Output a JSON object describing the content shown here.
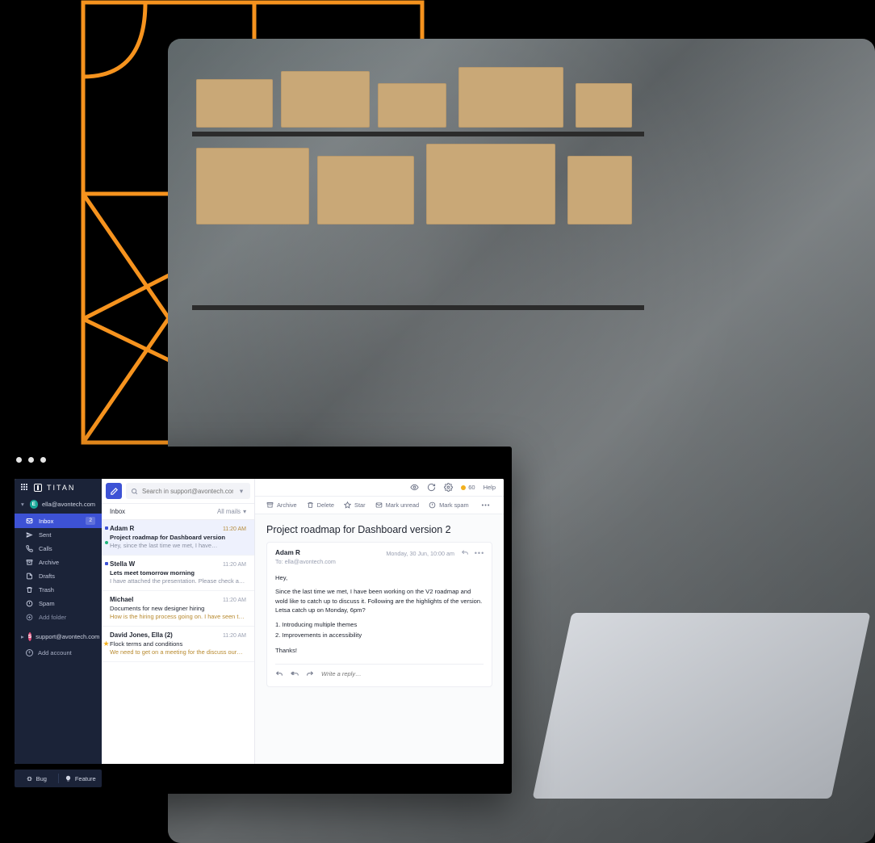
{
  "app": {
    "brand": "TITAN",
    "accounts": [
      {
        "label": "ella@avontech.com",
        "initial": "E",
        "color": "teal"
      },
      {
        "label": "support@avontech.com",
        "initial": "S",
        "color": "pink"
      }
    ],
    "add_account": "Add account",
    "nav": {
      "inbox": {
        "label": "Inbox",
        "badge": "2"
      },
      "sent": {
        "label": "Sent"
      },
      "calls": {
        "label": "Calls"
      },
      "archive": {
        "label": "Archive"
      },
      "drafts": {
        "label": "Drafts"
      },
      "trash": {
        "label": "Trash"
      },
      "spam": {
        "label": "Spam"
      },
      "add_folder": {
        "label": "Add folder"
      }
    },
    "bottom": {
      "bug": "Bug",
      "feature": "Feature"
    }
  },
  "search": {
    "placeholder": "Search in support@avontech.com"
  },
  "toolbar": {
    "count": "60",
    "help": "Help"
  },
  "listhead": {
    "title": "Inbox",
    "filter": "All mails"
  },
  "actions": {
    "archive": "Archive",
    "delete": "Delete",
    "star": "Star",
    "mark_unread": "Mark unread",
    "mark_spam": "Mark spam"
  },
  "mails": [
    {
      "from": "Adam R",
      "time": "11:20 AM",
      "subject": "Project roadmap for Dashboard version",
      "preview": "Hey, since the last time we met, I have…",
      "selected": true,
      "unread": true,
      "dotgreen": true
    },
    {
      "from": "Stella W",
      "time": "11:20 AM",
      "subject": "Lets meet tomorrow morning",
      "preview": "I have attached the presentation. Please check and…",
      "unread": true
    },
    {
      "from": "Michael",
      "time": "11:20 AM",
      "subject": "Documents for new designer hiring",
      "preview": "How is the hiring process going on. I have seen the…",
      "preview_hl": true
    },
    {
      "from": "David Jones, Ella (2)",
      "time": "11:20 AM",
      "subject": "Flock terms and conditions",
      "preview": "We need to get on a meeting for the discuss our…",
      "starred": true,
      "preview_hl": true
    }
  ],
  "reader": {
    "title": "Project roadmap for Dashboard version 2",
    "from": "Adam R",
    "to": "To: ella@avontech.com",
    "date": "Monday, 30 Jun, 10:00 am",
    "body": {
      "greeting": "Hey,",
      "p1": "Since the last time we met, I have been working on the V2 roadmap and wold like to catch up to discuss it. Following are the highlights of the version. Letsa catch up on Monday, 6pm?",
      "l1": "1. Introducing multiple themes",
      "l2": "2. Improvements in accessibility",
      "thanks": "Thanks!"
    },
    "reply_placeholder": "Write a reply…"
  }
}
